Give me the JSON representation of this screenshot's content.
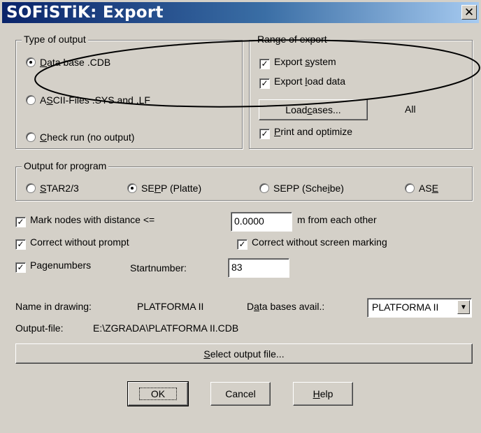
{
  "window": {
    "title": "SOFiSTiK: Export",
    "close_glyph": "✕"
  },
  "type_of_output": {
    "label": "Type of output",
    "options": [
      {
        "pre": "",
        "u": "D",
        "post": "ata base .CDB",
        "selected": true
      },
      {
        "pre": "A",
        "u": "S",
        "post": "CII-Files .SYS and .LF",
        "selected": false
      },
      {
        "pre": "",
        "u": "C",
        "post": "heck run (no output)",
        "selected": false
      }
    ]
  },
  "range_of_export": {
    "label": "Range of export",
    "export_system": {
      "pre": "Export ",
      "u": "s",
      "post": "ystem",
      "checked": true
    },
    "export_load_data": {
      "pre": "Export ",
      "u": "l",
      "post": "oad data",
      "checked": true
    },
    "load_cases_button": {
      "pre": "Load ",
      "u": "c",
      "post": "ases..."
    },
    "load_cases_value": "All",
    "print_optimize": {
      "pre": "",
      "u": "P",
      "post": "rint and optimize",
      "checked": true
    }
  },
  "output_for_program": {
    "label": "Output for program",
    "options": [
      {
        "pre": "",
        "u": "S",
        "post": "TAR2/3",
        "selected": false
      },
      {
        "pre": "SE",
        "u": "P",
        "post": "P (Platte)",
        "selected": true
      },
      {
        "pre": "SEPP (Sche",
        "u": "i",
        "post": "be)",
        "selected": false
      },
      {
        "pre": "AS",
        "u": "E",
        "post": "",
        "selected": false
      }
    ]
  },
  "mark_nodes": {
    "label": "Mark nodes with distance <=",
    "checked": true,
    "value": "0.0000",
    "suffix": "m from each other"
  },
  "correct_without_prompt": {
    "label": "Correct without prompt",
    "checked": true
  },
  "correct_without_marking": {
    "label": "Correct without screen marking",
    "checked": true
  },
  "pagenumbers": {
    "label": "Pagenumbers",
    "checked": true,
    "start_label": "Startnumber:",
    "start_value": "83"
  },
  "name_in_drawing": {
    "label": "Name in drawing:",
    "value": "PLATFORMA II"
  },
  "data_bases": {
    "label_pre": "D",
    "label_u": "a",
    "label_post": "ta bases avail.:",
    "selected": "PLATFORMA II"
  },
  "output_file": {
    "label": "Output-file:",
    "value": "E:\\ZGRADA\\PLATFORMA II.CDB"
  },
  "select_output_button": {
    "u": "S",
    "post": "elect output file..."
  },
  "buttons": {
    "ok": "OK",
    "cancel": "Cancel",
    "help_u": "H",
    "help_post": "elp"
  },
  "icons": {
    "check": "✓",
    "dropdown": "▼"
  }
}
